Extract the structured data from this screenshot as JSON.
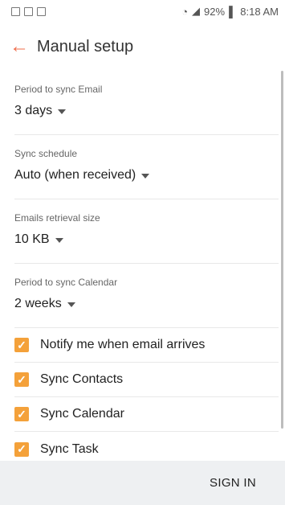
{
  "status_bar": {
    "icons": [
      "image-icon",
      "download-icon",
      "voicemail-icon"
    ],
    "right_icons": [
      "wifi-icon",
      "signal-icon",
      "battery-icon"
    ],
    "battery": "92%",
    "time": "8:18 AM"
  },
  "header": {
    "title": "Manual setup"
  },
  "settings": [
    {
      "label": "Period to sync Email",
      "value": "3 days"
    },
    {
      "label": "Sync schedule",
      "value": "Auto (when received)"
    },
    {
      "label": "Emails retrieval size",
      "value": "10 KB"
    },
    {
      "label": "Period to sync Calendar",
      "value": "2 weeks"
    }
  ],
  "checkboxes": [
    {
      "label": "Notify me when email arrives",
      "checked": true
    },
    {
      "label": "Sync Contacts",
      "checked": true
    },
    {
      "label": "Sync Calendar",
      "checked": true
    },
    {
      "label": "Sync Task",
      "checked": true
    }
  ],
  "footer": {
    "sign_in": "SIGN IN"
  },
  "colors": {
    "accent": "#f4a13a",
    "back_arrow": "#ef6c4a",
    "footer_bg": "#eef0f2"
  }
}
